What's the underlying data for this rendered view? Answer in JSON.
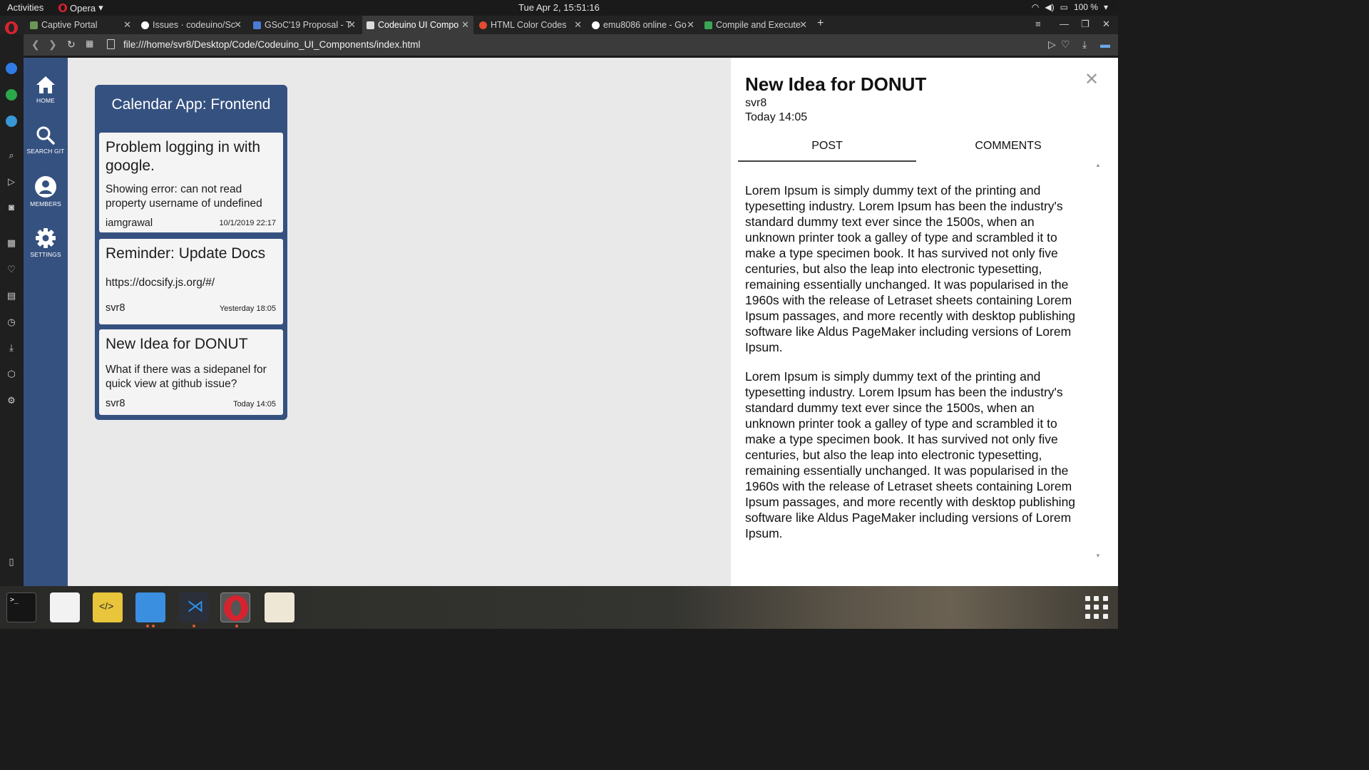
{
  "system": {
    "activities": "Activities",
    "app_name": "Opera",
    "clock": "Tue Apr  2, 15:51:16",
    "battery": "100 %"
  },
  "browser": {
    "tabs": [
      {
        "title": "Captive Portal",
        "color": "#6a9955"
      },
      {
        "title": "Issues · codeuino/Sc",
        "color": "#ffffff"
      },
      {
        "title": "GSoC'19 Proposal - T",
        "color": "#4a7bd6"
      },
      {
        "title": "Codeuino UI Compo",
        "color": "#dcdcdc"
      },
      {
        "title": "HTML Color Codes",
        "color": "#e14b32"
      },
      {
        "title": "emu8086 online - Go",
        "color": "#ffffff"
      },
      {
        "title": "Compile and Execute",
        "color": "#3aa655"
      }
    ],
    "new_tab": "+",
    "url": "file:///home/svr8/Desktop/Code/Codeuino_UI_Components/index.html"
  },
  "nav": {
    "items": [
      {
        "label": "HOME",
        "icon": "home-icon"
      },
      {
        "label": "SEARCH GIT",
        "icon": "search-icon"
      },
      {
        "label": "MEMBERS",
        "icon": "user-icon"
      },
      {
        "label": "SETTINGS",
        "icon": "gear-icon"
      }
    ]
  },
  "board": {
    "title": "Calendar App: Frontend",
    "issues": [
      {
        "title": "Problem logging in with google.",
        "description": "Showing error: can not read property username of undefined",
        "author": "iamgrawal",
        "date": "10/1/2019 22:17"
      },
      {
        "title": "Reminder: Update Docs",
        "description": "https://docsify.js.org/#/",
        "author": "svr8",
        "date": "Yesterday 18:05"
      },
      {
        "title": "New Idea for DONUT",
        "description": "What if there was a sidepanel for quick view at github issue?",
        "author": "svr8",
        "date": "Today 14:05"
      }
    ]
  },
  "detail": {
    "title": "New Idea for DONUT",
    "author": "svr8",
    "date": "Today 14:05",
    "close": "✕",
    "tabs": {
      "post": "POST",
      "comments": "COMMENTS"
    },
    "paragraphs": [
      "Lorem Ipsum is simply dummy text of the printing and typesetting industry. Lorem Ipsum has been the industry's standard dummy text ever since the 1500s, when an unknown printer took a galley of type and scrambled it to make a type specimen book. It has survived not only five centuries, but also the leap into electronic typesetting, remaining essentially unchanged. It was popularised in the 1960s with the release of Letraset sheets containing Lorem Ipsum passages, and more recently with desktop publishing software like Aldus PageMaker including versions of Lorem Ipsum.",
      "Lorem Ipsum is simply dummy text of the printing and typesetting industry. Lorem Ipsum has been the industry's standard dummy text ever since the 1500s, when an unknown printer took a galley of type and scrambled it to make a type specimen book. It has survived not only five centuries, but also the leap into electronic typesetting, remaining essentially unchanged. It was popularised in the 1960s with the release of Letraset sheets containing Lorem Ipsum passages, and more recently with desktop publishing software like Aldus PageMaker including versions of Lorem Ipsum."
    ]
  },
  "colors": {
    "nav_blue": "#355180",
    "page_bg": "#e9e9e9",
    "opera_red": "#d8232f"
  }
}
